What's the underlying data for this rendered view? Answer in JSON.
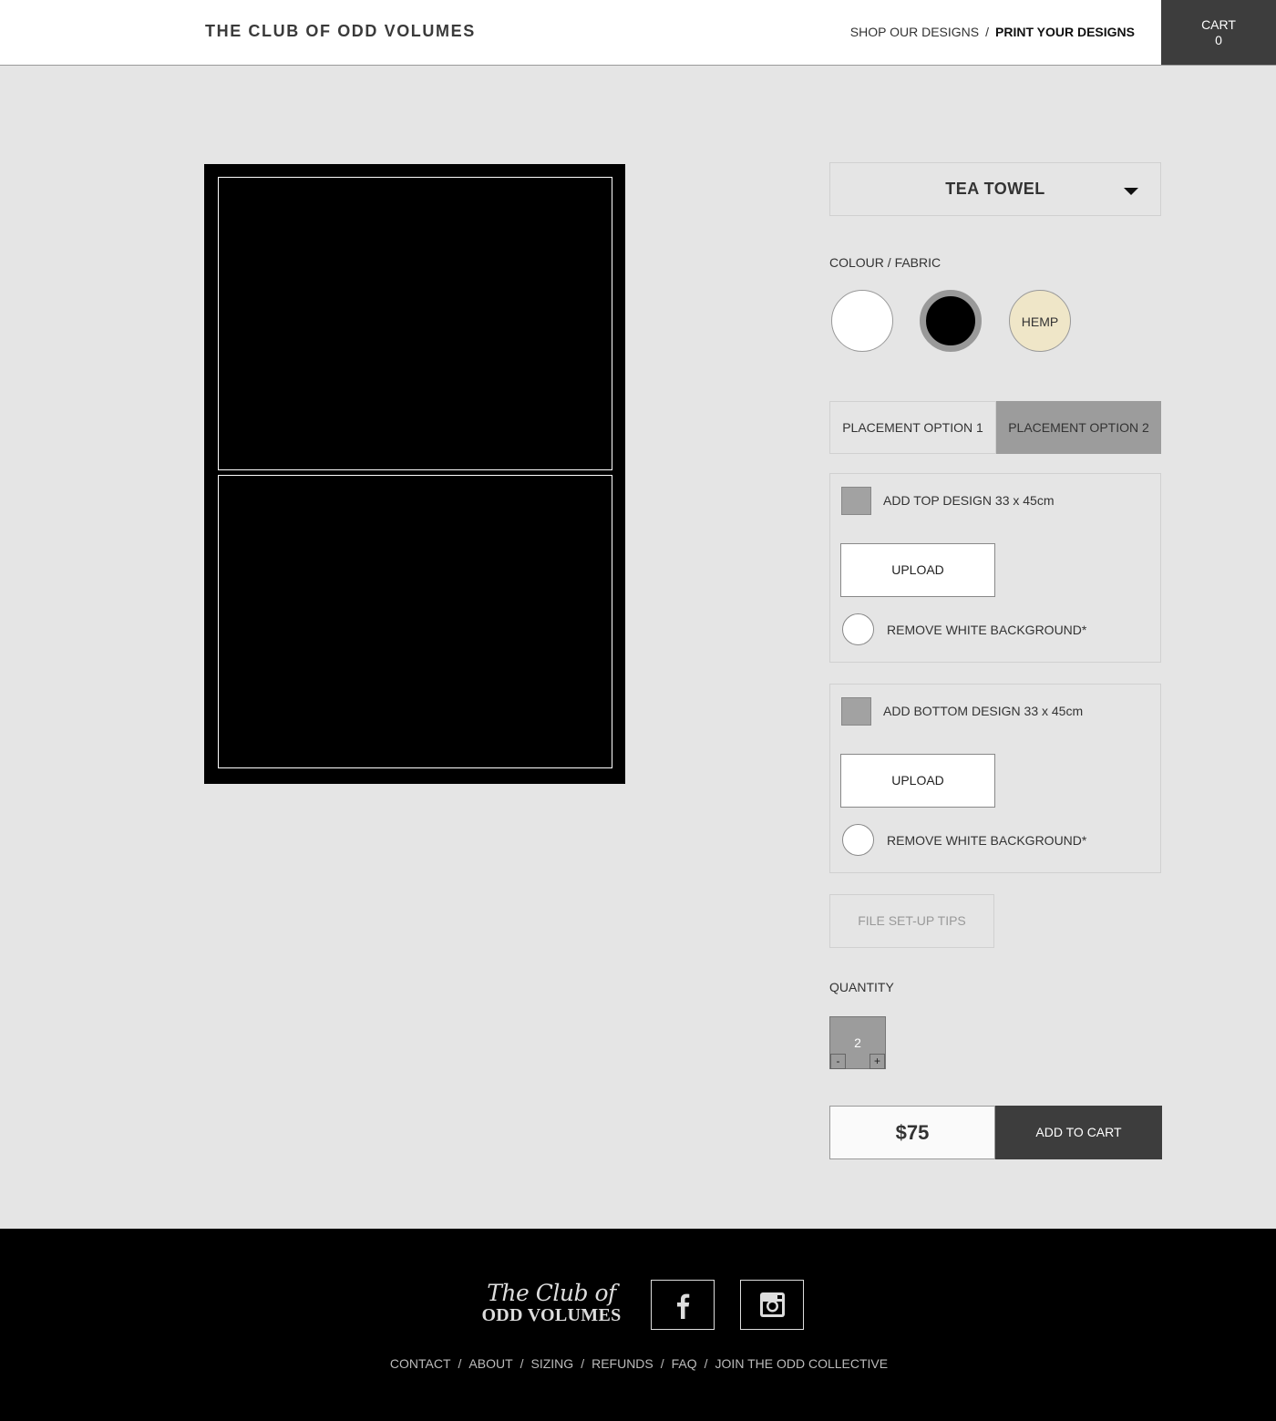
{
  "header": {
    "brand": "THE CLUB OF ODD VOLUMES",
    "nav": {
      "shop": "SHOP OUR DESIGNS",
      "separator": "/",
      "print": "PRINT YOUR DESIGNS"
    },
    "cart": {
      "label": "CART",
      "count": "0"
    }
  },
  "product": {
    "selected": "TEA TOWEL",
    "colour_label": "COLOUR / FABRIC",
    "swatches": [
      {
        "name": "white",
        "color": "#ffffff",
        "label": ""
      },
      {
        "name": "black",
        "color": "#000000",
        "label": "",
        "selected": true
      },
      {
        "name": "hemp",
        "color": "#efe6c8",
        "label": "HEMP"
      }
    ],
    "placement_options": [
      {
        "label": "PLACEMENT OPTION 1",
        "selected": false
      },
      {
        "label": "PLACEMENT OPTION 2",
        "selected": true
      }
    ],
    "top_design": {
      "label": "ADD TOP DESIGN 33 x 45cm",
      "upload": "UPLOAD",
      "remove_bg": "REMOVE WHITE BACKGROUND*"
    },
    "bottom_design": {
      "label": "ADD BOTTOM DESIGN 33 x 45cm",
      "upload": "UPLOAD",
      "remove_bg": "REMOVE WHITE BACKGROUND*"
    },
    "tips": "FILE SET-UP TIPS",
    "quantity_label": "QUANTITY",
    "quantity": "2",
    "minus": "-",
    "plus": "+",
    "price": "$75",
    "add_to_cart": "ADD TO CART"
  },
  "footer": {
    "logo_script": "The Club of",
    "logo_caps": "ODD VOLUMES",
    "links": [
      "CONTACT",
      "ABOUT",
      "SIZING",
      "REFUNDS",
      "FAQ",
      "JOIN THE ODD COLLECTIVE"
    ],
    "separator": "/"
  },
  "colors": {
    "page_bg": "#e5e5e5",
    "dark": "#3d3d3d",
    "selected_grey": "#9c9c9c",
    "hemp": "#efe6c8"
  }
}
